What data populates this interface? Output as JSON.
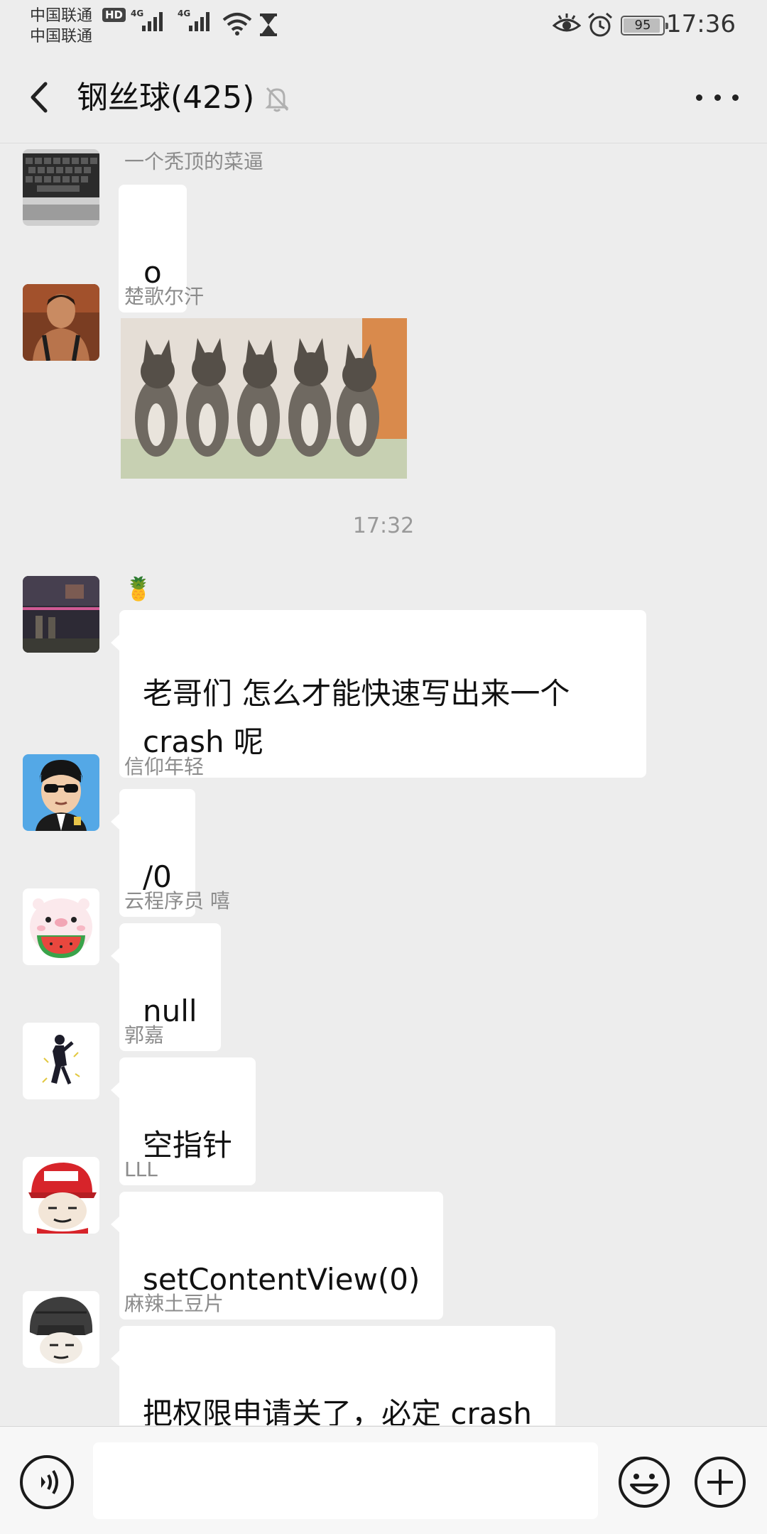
{
  "status_bar": {
    "carrier_1": "中国联通",
    "carrier_2": "中国联通",
    "hd_badge": "HD",
    "network_1": "4G",
    "network_2": "4G",
    "battery_percent": "95",
    "time": "17:36",
    "icons": [
      "signal-icon",
      "wifi-icon",
      "hourglass-icon",
      "eye-icon",
      "alarm-icon",
      "battery-icon"
    ]
  },
  "header": {
    "title": "钢丝球(425)",
    "icons": [
      "back-arrow-icon",
      "mute-bell-icon",
      "more-icon"
    ]
  },
  "messages": [
    {
      "sender": "一个秃顶的菜逼",
      "text": "o"
    },
    {
      "sender": "楚歌尔汗",
      "image": "kittens-image"
    },
    {
      "divider": "17:32"
    },
    {
      "sender": "🍍",
      "text": "老哥们 怎么才能快速写出来一个\ncrash 呢"
    },
    {
      "sender": "信仰年轻",
      "text": "/0"
    },
    {
      "sender": "云程序员 嘻",
      "text": "null"
    },
    {
      "sender": "郭嘉",
      "text": "空指针"
    },
    {
      "sender": "LLL",
      "text": "setContentView(0)"
    },
    {
      "sender": "麻辣土豆片",
      "text": "把权限申请关了，必定 crash"
    }
  ],
  "input_bar": {
    "placeholder": "",
    "icons": [
      "voice-icon",
      "emoji-icon",
      "plus-icon"
    ]
  }
}
